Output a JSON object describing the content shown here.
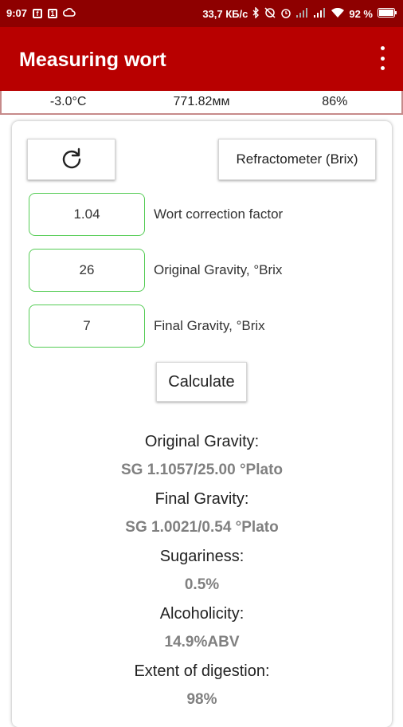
{
  "status": {
    "time": "9:07",
    "speed": "33,7 КБ/с",
    "battery": "92 %"
  },
  "appbar": {
    "title": "Measuring wort"
  },
  "infobar": {
    "temperature": "-3.0°C",
    "pressure": "771.82мм",
    "humidity": "86%"
  },
  "controls": {
    "mode_button": "Refractometer (Brix)",
    "calculate_button": "Calculate"
  },
  "fields": [
    {
      "value": "1.04",
      "label": "Wort correction factor"
    },
    {
      "value": "26",
      "label": "Original Gravity, °Brix"
    },
    {
      "value": "7",
      "label": "Final Gravity, °Brix"
    }
  ],
  "results": [
    {
      "label": "Original Gravity:",
      "value": "SG 1.1057/25.00 °Plato"
    },
    {
      "label": "Final Gravity:",
      "value": "SG 1.0021/0.54 °Plato"
    },
    {
      "label": "Sugariness:",
      "value": "0.5%"
    },
    {
      "label": "Alcoholicity:",
      "value": "14.9%ABV"
    },
    {
      "label": "Extent of digestion:",
      "value": "98%"
    }
  ],
  "colors": {
    "statusbar": "#8e0000",
    "appbar": "#b80000",
    "field_border": "#55cc55",
    "result_value": "#808080"
  }
}
